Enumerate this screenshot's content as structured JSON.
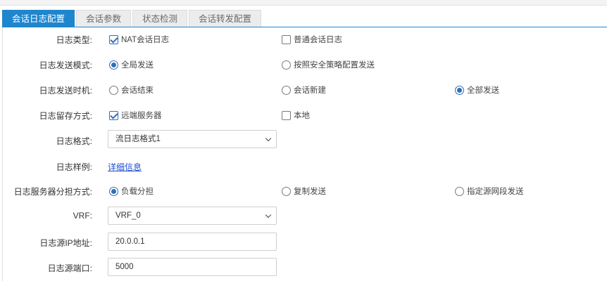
{
  "tabs": [
    "会话日志配置",
    "会话参数",
    "状态检测",
    "会话转发配置"
  ],
  "form": {
    "log_type": {
      "label": "日志类型:",
      "options": [
        {
          "text": "NAT会话日志",
          "checked": true
        },
        {
          "text": "普通会话日志",
          "checked": false
        }
      ]
    },
    "send_mode": {
      "label": "日志发送模式:",
      "options": [
        {
          "text": "全局发送",
          "checked": true
        },
        {
          "text": "按照安全策略配置发送",
          "checked": false
        }
      ]
    },
    "send_timing": {
      "label": "日志发送时机:",
      "options": [
        {
          "text": "会话结束",
          "checked": false
        },
        {
          "text": "会话新建",
          "checked": false
        },
        {
          "text": "全部发送",
          "checked": true
        }
      ]
    },
    "retention": {
      "label": "日志留存方式:",
      "options": [
        {
          "text": "远端服务器",
          "checked": true
        },
        {
          "text": "本地",
          "checked": false
        }
      ]
    },
    "format": {
      "label": "日志格式:",
      "value": "流日志格式1"
    },
    "sample": {
      "label": "日志样例:",
      "link": "详细信息"
    },
    "load_sharing": {
      "label": "日志服务器分担方式:",
      "options": [
        {
          "text": "负载分担",
          "checked": true
        },
        {
          "text": "复制发送",
          "checked": false
        },
        {
          "text": "指定源网段发送",
          "checked": false
        }
      ]
    },
    "vrf": {
      "label": "VRF:",
      "value": "VRF_0"
    },
    "src_ip": {
      "label": "日志源IP地址:",
      "value": "20.0.0.1"
    },
    "src_port": {
      "label": "日志源端口:",
      "value": "5000"
    }
  }
}
